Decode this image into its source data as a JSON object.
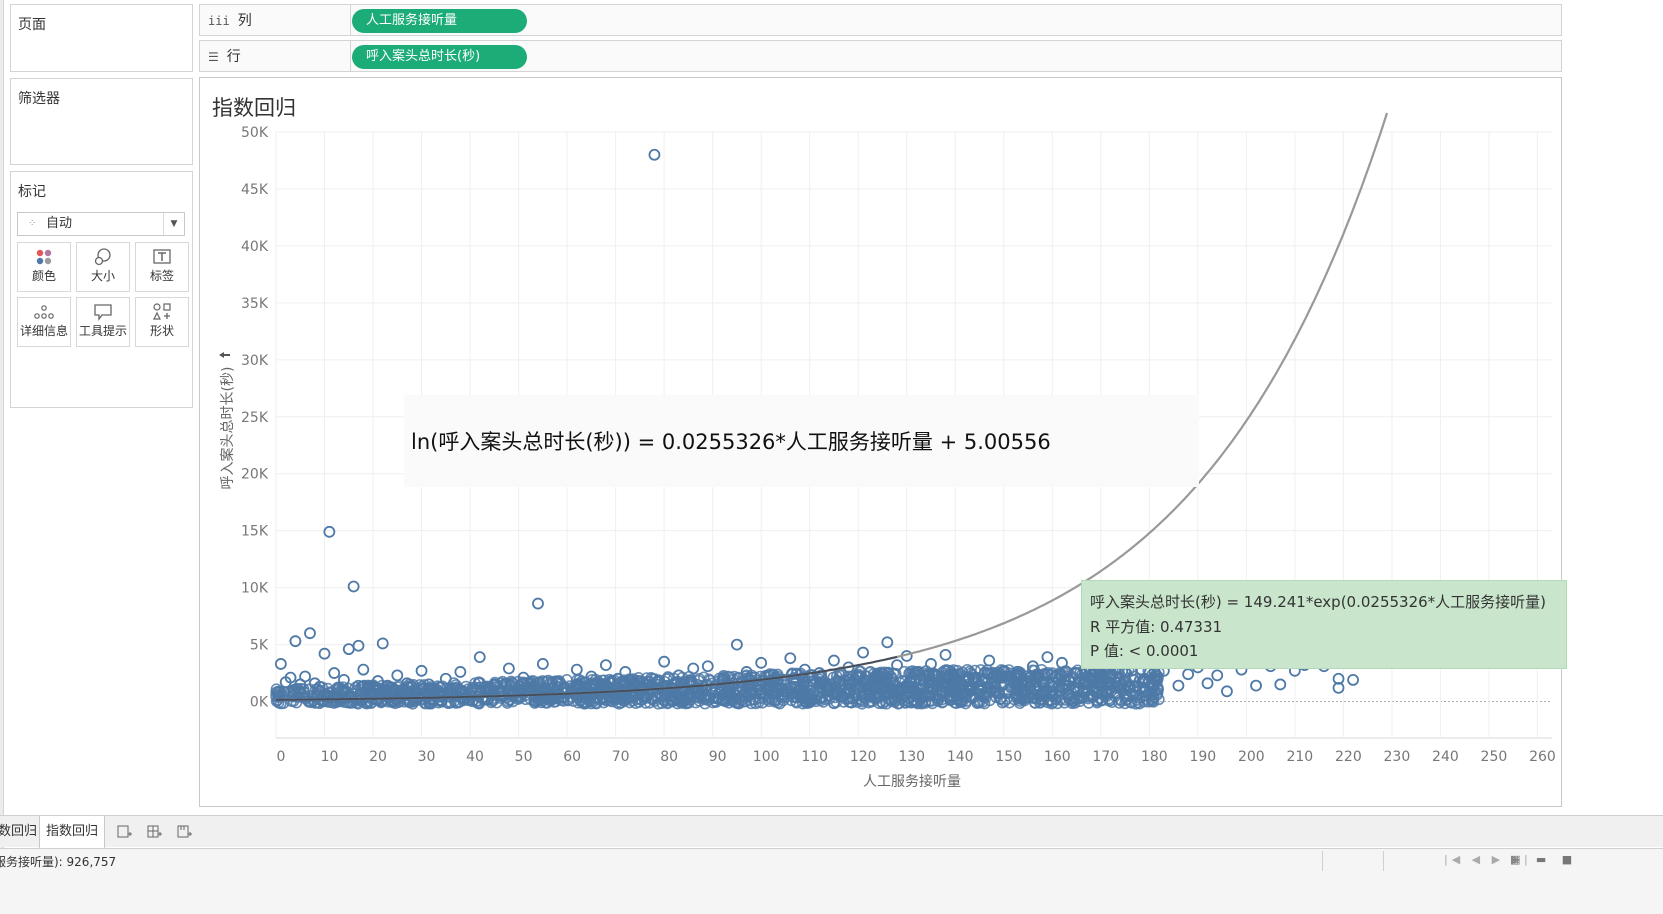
{
  "shelves": {
    "pages_label": "页面",
    "filters_label": "筛选器",
    "marks_label": "标记",
    "columns": {
      "icon": "iii",
      "label": "列",
      "pill": "人工服务接听量"
    },
    "rows": {
      "icon": "☰",
      "label": "行",
      "pill": "呼入案头总时长(秒)"
    }
  },
  "marks": {
    "type": "自动",
    "buttons": [
      {
        "label": "颜色",
        "icon": "color-icon"
      },
      {
        "label": "大小",
        "icon": "size-icon"
      },
      {
        "label": "标签",
        "icon": "label-icon"
      },
      {
        "label": "详细信息",
        "icon": "detail-icon"
      },
      {
        "label": "工具提示",
        "icon": "tooltip-icon"
      },
      {
        "label": "形状",
        "icon": "shape-icon"
      }
    ]
  },
  "viz": {
    "title": "指数回归",
    "formula_overlay": "ln(呼入案头总时长(秒)) = 0.0255326*人工服务接听量 + 5.00556",
    "tooltip": {
      "line1": "呼入案头总时长(秒) = 149.241*exp(0.0255326*人工服务接听量)",
      "line2": "R 平方值: 0.47331",
      "line3": "P 值: < 0.0001"
    }
  },
  "tabs": {
    "prev_tab": "数回归",
    "active_tab": "指数回归"
  },
  "status": {
    "text": "服务接听量): 926,757"
  },
  "colors": {
    "pill": "#1cac78",
    "mark": "#4e79a7",
    "trend": "#999999",
    "tooltip_bg": "#c9e6cd"
  },
  "chart_data": {
    "type": "scatter",
    "title": "指数回归",
    "xlabel": "人工服务接听量",
    "ylabel": "呼入案头总时长(秒)",
    "xlim": [
      0,
      263
    ],
    "ylim": [
      -3200,
      50000
    ],
    "x_ticks": [
      0,
      10,
      20,
      30,
      40,
      50,
      60,
      70,
      80,
      90,
      100,
      110,
      120,
      130,
      140,
      150,
      160,
      170,
      180,
      190,
      200,
      210,
      220,
      230,
      240,
      250,
      260
    ],
    "y_ticks": [
      0,
      5000,
      10000,
      15000,
      20000,
      25000,
      30000,
      35000,
      40000,
      45000,
      50000
    ],
    "y_tick_labels": [
      "0K",
      "5K",
      "10K",
      "15K",
      "20K",
      "25K",
      "30K",
      "35K",
      "40K",
      "45K",
      "50K"
    ],
    "grid": true,
    "trendline": {
      "model": "exponential",
      "a": 149.241,
      "b": 0.0255326,
      "r_squared": 0.47331,
      "p_value": "< 0.0001"
    },
    "points": [
      [
        78,
        48000
      ],
      [
        11,
        14900
      ],
      [
        16,
        10100
      ],
      [
        54,
        8600
      ],
      [
        7,
        6000
      ],
      [
        4,
        5300
      ],
      [
        17,
        4900
      ],
      [
        15,
        4600
      ],
      [
        10,
        4200
      ],
      [
        22,
        5100
      ],
      [
        1,
        3300
      ],
      [
        3,
        2100
      ],
      [
        2,
        1700
      ],
      [
        5,
        1500
      ],
      [
        6,
        2200
      ],
      [
        8,
        1600
      ],
      [
        9,
        1300
      ],
      [
        12,
        2500
      ],
      [
        14,
        1900
      ],
      [
        18,
        2800
      ],
      [
        19,
        1200
      ],
      [
        21,
        1800
      ],
      [
        23,
        1400
      ],
      [
        25,
        2300
      ],
      [
        27,
        1600
      ],
      [
        30,
        2700
      ],
      [
        32,
        1100
      ],
      [
        35,
        2000
      ],
      [
        38,
        2600
      ],
      [
        42,
        3900
      ],
      [
        45,
        1500
      ],
      [
        48,
        2900
      ],
      [
        51,
        2100
      ],
      [
        55,
        3300
      ],
      [
        58,
        1700
      ],
      [
        62,
        2800
      ],
      [
        65,
        2200
      ],
      [
        68,
        3200
      ],
      [
        72,
        2600
      ],
      [
        75,
        1800
      ],
      [
        80,
        3500
      ],
      [
        83,
        2300
      ],
      [
        86,
        2900
      ],
      [
        89,
        3100
      ],
      [
        92,
        2000
      ],
      [
        95,
        5000
      ],
      [
        97,
        2600
      ],
      [
        100,
        3400
      ],
      [
        103,
        2100
      ],
      [
        106,
        3800
      ],
      [
        109,
        2800
      ],
      [
        112,
        2500
      ],
      [
        115,
        3600
      ],
      [
        118,
        3000
      ],
      [
        121,
        4300
      ],
      [
        124,
        2400
      ],
      [
        126,
        5200
      ],
      [
        128,
        3200
      ],
      [
        130,
        4000
      ],
      [
        132,
        2600
      ],
      [
        135,
        3300
      ],
      [
        138,
        4100
      ],
      [
        141,
        2400
      ],
      [
        144,
        2000
      ],
      [
        147,
        3600
      ],
      [
        150,
        2700
      ],
      [
        153,
        2300
      ],
      [
        156,
        3100
      ],
      [
        159,
        3900
      ],
      [
        162,
        3400
      ],
      [
        165,
        2500
      ],
      [
        168,
        2800
      ],
      [
        170,
        3300
      ],
      [
        172,
        2200
      ],
      [
        175,
        2600
      ],
      [
        177,
        1300
      ],
      [
        179,
        2000
      ],
      [
        181,
        1500
      ],
      [
        183,
        2700
      ],
      [
        186,
        1400
      ],
      [
        188,
        2400
      ],
      [
        190,
        3000
      ],
      [
        192,
        1600
      ],
      [
        194,
        2300
      ],
      [
        196,
        900
      ],
      [
        199,
        2800
      ],
      [
        202,
        1400
      ],
      [
        205,
        3100
      ],
      [
        207,
        1500
      ],
      [
        210,
        2700
      ],
      [
        212,
        3200
      ],
      [
        216,
        3100
      ],
      [
        219,
        2000
      ],
      [
        219,
        1200
      ],
      [
        222,
        1900
      ],
      [
        228,
        3600
      ]
    ]
  }
}
